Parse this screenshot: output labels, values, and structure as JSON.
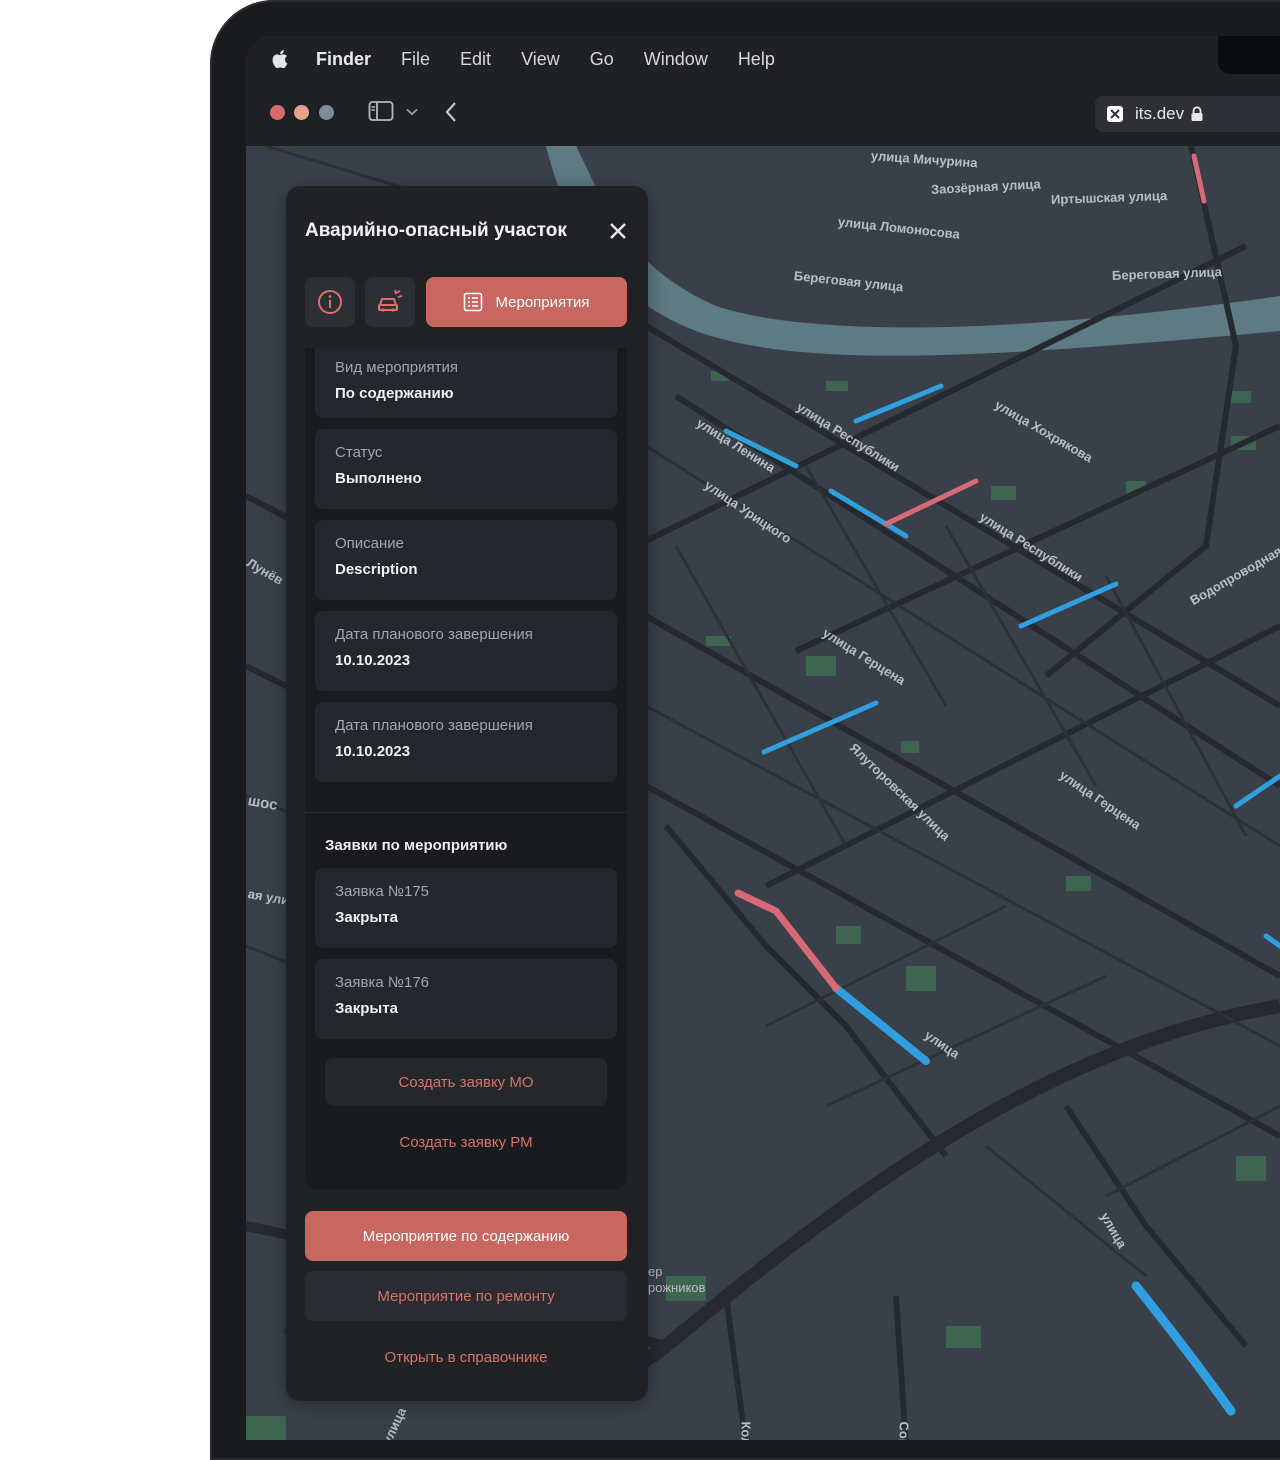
{
  "menubar": {
    "app_name": "Finder",
    "items": [
      "File",
      "Edit",
      "View",
      "Go",
      "Window",
      "Help"
    ]
  },
  "browser": {
    "url": "its.dev"
  },
  "map": {
    "streets": [
      "улица Мичурина",
      "Заозёрная улица",
      "Иртышская улица",
      "улица Ломоносова",
      "Береговая улица",
      "Береговая улица",
      "улица Республики",
      "улица Хохрякова",
      "улица Ленина",
      "улица Урицкого",
      "улица Республики",
      "Водопроводная",
      "улица Герцена",
      "Ялуторовская улица",
      "улица Герцена",
      "улица",
      "улица",
      "Колх",
      "Сок",
      "Лунёв",
      "шос",
      "ая ули",
      "улица"
    ],
    "poi": [
      "ер",
      "рожников"
    ]
  },
  "panel": {
    "title": "Аварийно-опасный участок",
    "tabs": {
      "info_icon": "info-icon",
      "car_icon": "car-crash-icon",
      "active_label": "Мероприятия"
    },
    "fields": [
      {
        "label": "Вид мероприятия",
        "value": "По содержанию"
      },
      {
        "label": "Статус",
        "value": "Выполнено"
      },
      {
        "label": "Описание",
        "value": "Description"
      },
      {
        "label": "Дата планового завершения",
        "value": "10.10.2023"
      },
      {
        "label": "Дата планового завершения",
        "value": "10.10.2023"
      }
    ],
    "requests_title": "Заявки по мероприятию",
    "requests": [
      {
        "label": "Заявка №175",
        "value": "Закрыта"
      },
      {
        "label": "Заявка №176",
        "value": "Закрыта"
      }
    ],
    "create_mo": "Создать заявку МО",
    "create_rm": "Создать заявку РМ",
    "btn_maintenance": "Мероприятие по содержанию",
    "btn_repair": "Мероприятие по ремонту",
    "btn_open_ref": "Открыть в справочнике"
  },
  "colors": {
    "accent": "#c7675f",
    "road_blue": "#2f9fe0",
    "road_red": "#d86a78",
    "river": "#5e7a83"
  }
}
